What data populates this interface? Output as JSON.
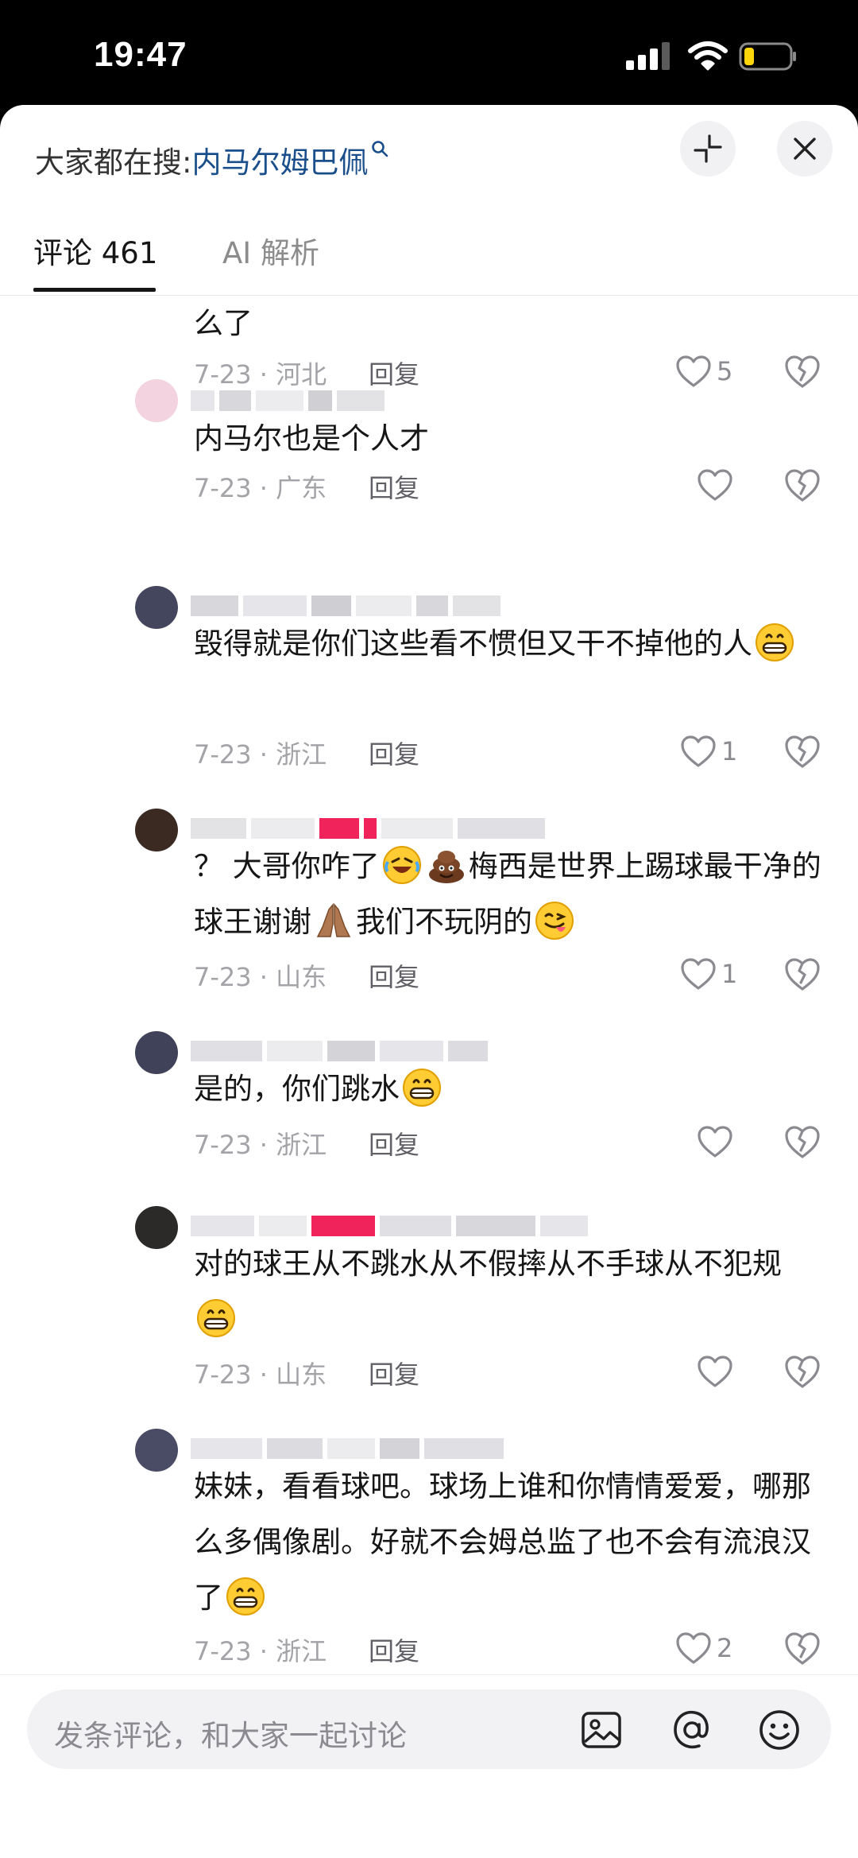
{
  "status_bar": {
    "time": "19:47",
    "battery_level": 0.2
  },
  "header": {
    "search_prefix": "大家都在搜:",
    "search_keyword": "内马尔姆巴佩",
    "icons": [
      "search-icon",
      "collapse-icon",
      "close-icon"
    ]
  },
  "tabs": [
    {
      "label": "评论 461",
      "active": true
    },
    {
      "label": "AI 解析",
      "active": false
    }
  ],
  "comments": [
    {
      "text": "么了",
      "meta": "7-23 · 河北",
      "reply": "回复",
      "likes": "5"
    },
    {
      "text": "内马尔也是个人才",
      "meta": "7-23 · 广东",
      "reply": "回复",
      "likes": ""
    },
    {
      "text": "毁得就是你们这些看不惯但又干不掉他的人",
      "emoji": "grin-emoji",
      "meta": "7-23 · 浙江",
      "reply": "回复",
      "likes": "1"
    },
    {
      "text_a": "？ 大哥你咋了",
      "text_b": "梅西是世界上踢球最干净的球王谢谢",
      "text_c": "我们不玩阴的",
      "meta": "7-23 · 山东",
      "reply": "回复",
      "likes": "1"
    },
    {
      "text": "是的，你们跳水",
      "emoji": "grin-emoji",
      "meta": "7-23 · 浙江",
      "reply": "回复",
      "likes": ""
    },
    {
      "text": "对的球王从不跳水从不假摔从不手球从不犯规",
      "emoji": "grin-emoji",
      "meta": "7-23 · 山东",
      "reply": "回复",
      "likes": ""
    },
    {
      "text": "妹妹，看看球吧。球场上谁和你情情爱爱，哪那么多偶像剧。好就不会姆总监了也不会有流浪汉了",
      "emoji": "grin-emoji",
      "meta": "7-23 · 浙江",
      "reply": "回复",
      "likes": "2"
    }
  ],
  "input_bar": {
    "placeholder": "发条评论，和大家一起讨论",
    "icons": [
      "image-icon",
      "at-icon",
      "emoji-icon"
    ]
  },
  "colors": {
    "keyword": "#1a4f8b",
    "text": "#161616",
    "meta": "#a3a3a8",
    "accent_pink": "#f0245a"
  }
}
